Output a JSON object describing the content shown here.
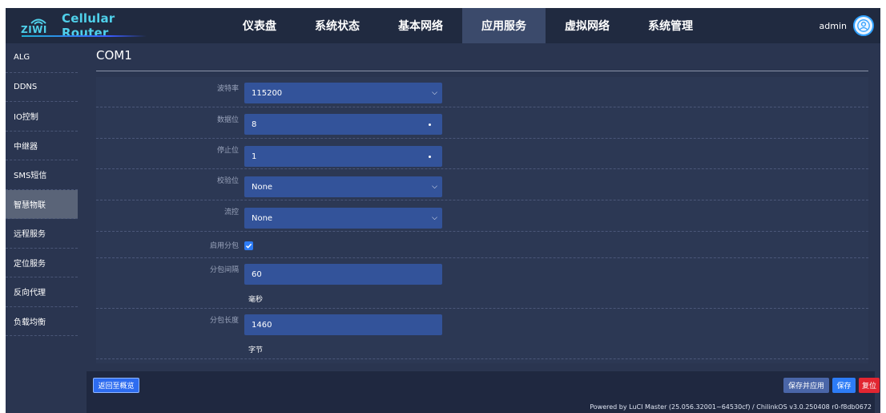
{
  "brand": {
    "logo_text": "ZIWI",
    "name": "Cellular Router"
  },
  "nav": {
    "items": [
      {
        "label": "仪表盘"
      },
      {
        "label": "系统状态"
      },
      {
        "label": "基本网络"
      },
      {
        "label": "应用服务",
        "active": true
      },
      {
        "label": "虚拟网络"
      },
      {
        "label": "系统管理"
      }
    ],
    "user": "admin"
  },
  "sidebar": {
    "items": [
      {
        "label": "ALG"
      },
      {
        "label": "DDNS"
      },
      {
        "label": "IO控制"
      },
      {
        "label": "中继器"
      },
      {
        "label": "SMS短信"
      },
      {
        "label": "智慧物联",
        "active": true
      },
      {
        "label": "远程服务"
      },
      {
        "label": "定位服务"
      },
      {
        "label": "反向代理"
      },
      {
        "label": "负载均衡"
      }
    ]
  },
  "page": {
    "title": "COM1"
  },
  "form": {
    "baud_rate": {
      "label": "波特率",
      "value": "115200"
    },
    "data_bits": {
      "label": "数据位",
      "value": "8"
    },
    "stop_bits": {
      "label": "停止位",
      "value": "1"
    },
    "parity": {
      "label": "校验位",
      "value": "None"
    },
    "flow_control": {
      "label": "流控",
      "value": "None"
    },
    "enable_packet": {
      "label": "启用分包",
      "checked": true
    },
    "packet_interval": {
      "label": "分包间隔",
      "value": "60",
      "unit": "毫秒"
    },
    "packet_length": {
      "label": "分包长度",
      "value": "1460",
      "unit": "字节"
    }
  },
  "footer": {
    "back_label": "返回至概览",
    "save_apply_label": "保存并应用",
    "save_label": "保存",
    "reset_label": "复位",
    "powered_by": "Powered by LuCI Master (25.056.32001~64530cf) / ChilinkOS v3.0.250408 r0-f8db0672"
  },
  "colors": {
    "background": "#2a3550",
    "topnav": "#202a40",
    "field": "#33539a",
    "accent": "#2d7cf6",
    "danger": "#e22631",
    "brand": "#4fd0ea"
  }
}
